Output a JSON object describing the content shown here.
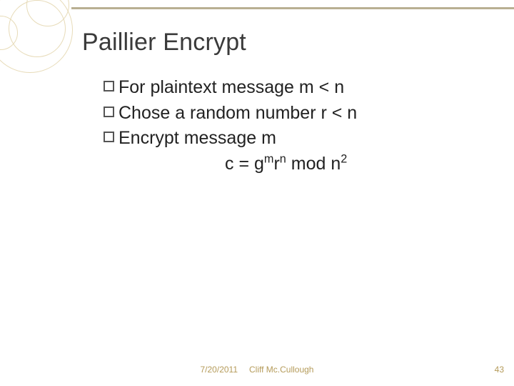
{
  "slide": {
    "title": "Paillier Encrypt",
    "bullets": [
      "For plaintext message m < n",
      "Chose a random number r < n",
      "Encrypt message m"
    ],
    "formula_html": "c = g<sup>m</sup>r<sup>n</sup> mod n<sup>2</sup>"
  },
  "footer": {
    "date": "7/20/2011",
    "author": "Cliff Mc.Cullough",
    "page": "43"
  },
  "colors": {
    "accent": "#b59b5a",
    "deco": "#e7dbb8"
  }
}
